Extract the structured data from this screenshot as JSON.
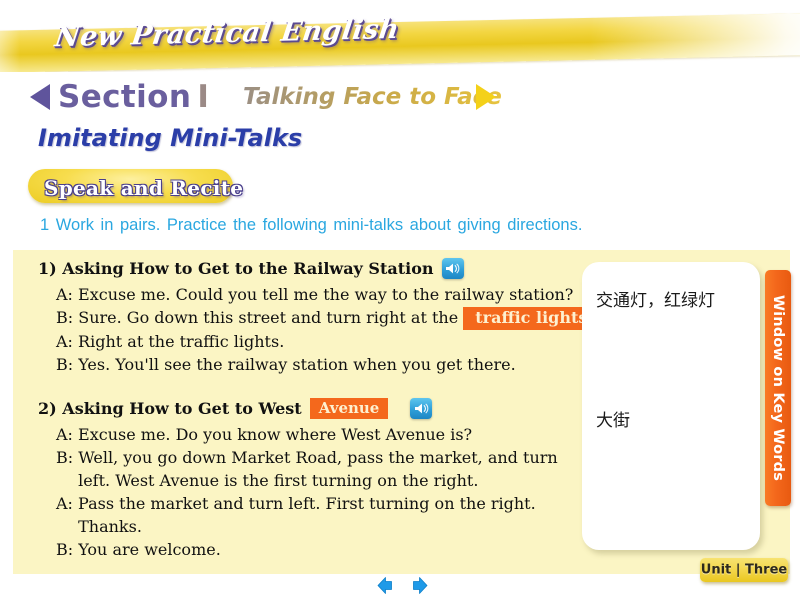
{
  "banner": {
    "title": "New Practical English"
  },
  "header": {
    "section_label": "Section",
    "section_number": "I",
    "section_subtitle": "Talking Face to Face",
    "page_subtitle": "Imitating Mini-Talks",
    "activity_badge": "Speak and Recite",
    "instruction": "1 Work in pairs. Practice the following mini-talks about giving directions."
  },
  "dialogues": [
    {
      "heading_prefix": "1) Asking How to Get to the Railway Station",
      "heading_highlight": "",
      "heading_suffix": "",
      "speaker_icon": "speaker-icon",
      "lines": [
        {
          "speaker": "A:",
          "pre": "Excuse me. Could you tell me the way to the railway station?",
          "highlight": "",
          "post": ""
        },
        {
          "speaker": "B:",
          "pre": "Sure. Go down this street and turn right at the",
          "highlight": "traffic lights",
          "post": "."
        },
        {
          "speaker": "A:",
          "pre": "Right at the traffic lights.",
          "highlight": "",
          "post": ""
        },
        {
          "speaker": "B:",
          "pre": "Yes. You'll see the railway station when you get there.",
          "highlight": "",
          "post": ""
        }
      ]
    },
    {
      "heading_prefix": "2) Asking How to Get to West",
      "heading_highlight": "Avenue",
      "heading_suffix": "",
      "speaker_icon": "speaker-icon",
      "lines": [
        {
          "speaker": "A:",
          "pre": "Excuse me. Do you know where West Avenue is?",
          "highlight": "",
          "post": ""
        },
        {
          "speaker": "B:",
          "pre": "Well, you go down Market Road, pass the market, and turn",
          "highlight": "",
          "post": ""
        },
        {
          "speaker": "",
          "pre": "left. West Avenue is the first turning on the right.",
          "highlight": "",
          "post": ""
        },
        {
          "speaker": "A:",
          "pre": "Pass the market and turn left. First turning on the right.",
          "highlight": "",
          "post": ""
        },
        {
          "speaker": "",
          "pre": "Thanks.",
          "highlight": "",
          "post": ""
        },
        {
          "speaker": "B:",
          "pre": "You are welcome.",
          "highlight": "",
          "post": ""
        }
      ]
    }
  ],
  "key_words_window": {
    "tab_label": "Window on Key Words",
    "entry_1": "交通灯，红绿灯",
    "entry_2": "大街"
  },
  "footer": {
    "prev_label": "prev-arrow-icon",
    "next_label": "next-arrow-icon",
    "unit_badge": "Unit | Three"
  },
  "colors": {
    "banner_yellow": "#f3d642",
    "panel_yellow": "#fbf5c4",
    "highlight_orange": "#f4681c",
    "instruction_blue": "#2aa7e0",
    "subtitle_blue": "#2b3ea8",
    "section_purple": "#6a5f9e",
    "section_number_taupe": "#9b8a86",
    "nav_arrow_blue": "#1f9ae8"
  }
}
